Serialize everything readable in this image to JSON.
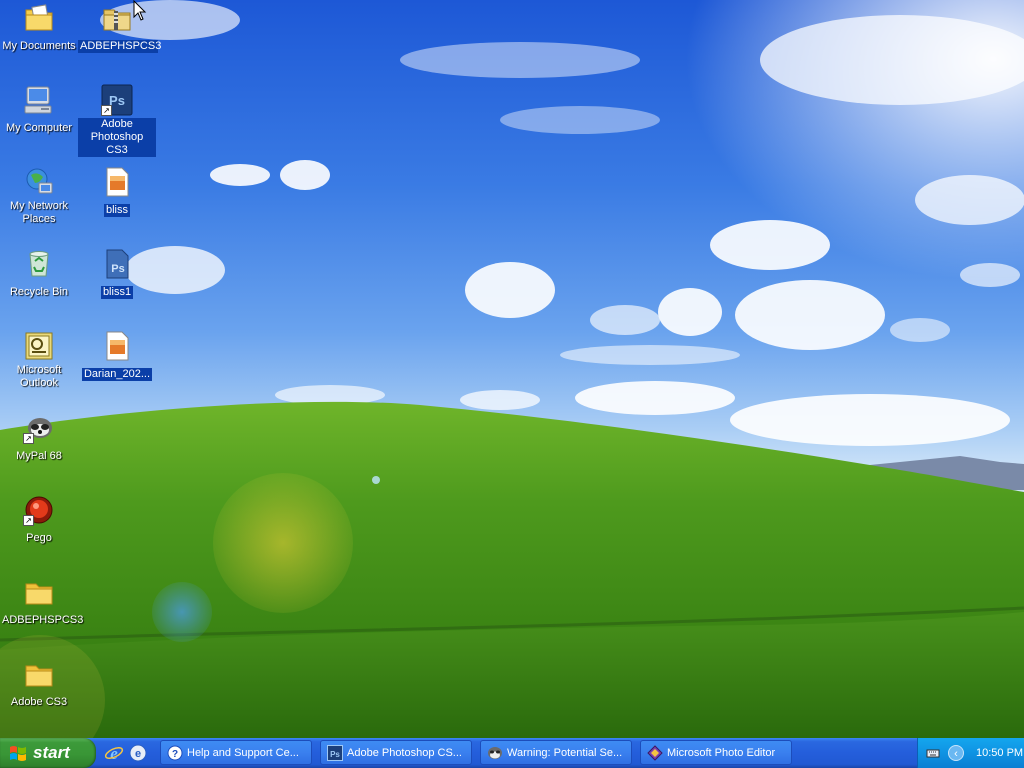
{
  "desktop": {
    "icons": [
      {
        "label": "My Documents",
        "icon": "my-documents-icon"
      },
      {
        "label": "ADBEPHSPCS3",
        "icon": "zip-folder-icon"
      },
      {
        "label": "My Computer",
        "icon": "my-computer-icon"
      },
      {
        "label": "Adobe Photoshop CS3",
        "icon": "photoshop-icon"
      },
      {
        "label": "My Network Places",
        "icon": "network-places-icon"
      },
      {
        "label": "bliss",
        "icon": "image-file-icon"
      },
      {
        "label": "Recycle Bin",
        "icon": "recycle-bin-icon"
      },
      {
        "label": "bliss1",
        "icon": "psd-file-icon"
      },
      {
        "label": "Microsoft Outlook",
        "icon": "outlook-icon"
      },
      {
        "label": "Darian_202...",
        "icon": "image-file-icon"
      },
      {
        "label": "MyPal 68",
        "icon": "mypal-icon"
      },
      {
        "label": "Pego",
        "icon": "pego-icon"
      },
      {
        "label": "ADBEPHSPCS3",
        "icon": "folder-icon"
      },
      {
        "label": "Adobe CS3",
        "icon": "folder-icon"
      }
    ]
  },
  "taskbar": {
    "start_label": "start",
    "quick_launch": [
      "internet-explorer-icon",
      "show-desktop-icon"
    ],
    "tasks": [
      {
        "label": "Help and Support Ce...",
        "icon": "help-icon"
      },
      {
        "label": "Adobe Photoshop CS...",
        "icon": "photoshop-icon"
      },
      {
        "label": "Warning: Potential Se...",
        "icon": "mypal-icon"
      },
      {
        "label": "Microsoft Photo Editor",
        "icon": "photo-editor-icon"
      }
    ],
    "tray": {
      "clock": "10:50 PM"
    }
  },
  "colors": {
    "taskbar": "#245edb",
    "start": "#3c9a3a",
    "tray": "#0f93e3",
    "selection": "#0b3fa8"
  }
}
